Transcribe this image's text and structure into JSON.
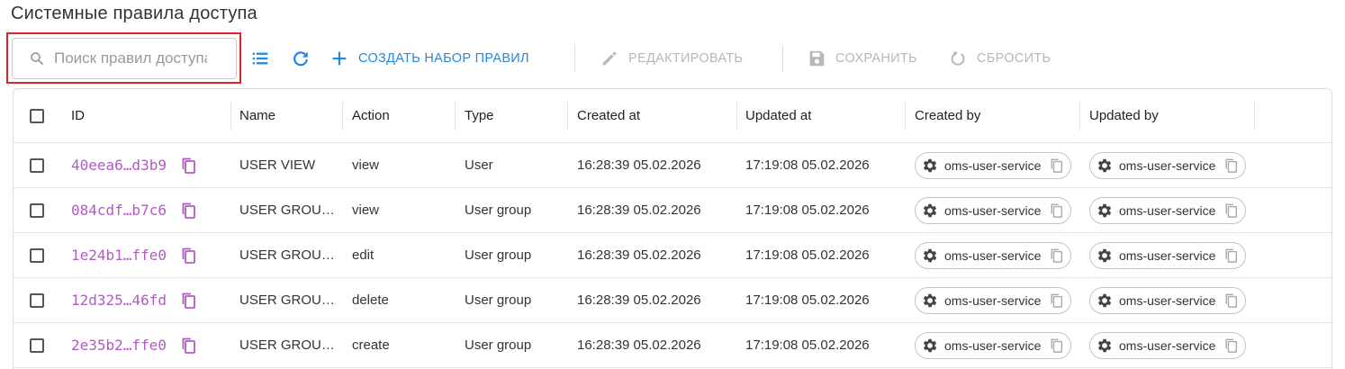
{
  "page": {
    "title": "Системные правила доступа"
  },
  "toolbar": {
    "search_placeholder": "Поиск правил доступа",
    "columns_icon": "list-icon",
    "refresh_icon": "refresh-icon",
    "create_label": "СОЗДАТЬ НАБОР ПРАВИЛ",
    "edit_label": "РЕДАКТИРОВАТЬ",
    "save_label": "СОХРАНИТЬ",
    "reset_label": "СБРОСИТЬ"
  },
  "colors": {
    "accent": "#1e88e5",
    "id_text": "#b05cc2",
    "disabled": "#b7b7b7",
    "highlight": "#d9232d"
  },
  "table": {
    "columns": [
      "ID",
      "Name",
      "Action",
      "Type",
      "Created at",
      "Updated at",
      "Created by",
      "Updated by"
    ],
    "rows": [
      {
        "id": "40eea6…d3b9",
        "name": "USER VIEW",
        "action": "view",
        "type": "User",
        "created_at": "16:28:39 05.02.2026",
        "updated_at": "17:19:08 05.02.2026",
        "created_by": "oms-user-service",
        "updated_by": "oms-user-service"
      },
      {
        "id": "084cdf…b7c6",
        "name": "USER GROU…",
        "action": "view",
        "type": "User group",
        "created_at": "16:28:39 05.02.2026",
        "updated_at": "17:19:08 05.02.2026",
        "created_by": "oms-user-service",
        "updated_by": "oms-user-service"
      },
      {
        "id": "1e24b1…ffe0",
        "name": "USER GROU…",
        "action": "edit",
        "type": "User group",
        "created_at": "16:28:39 05.02.2026",
        "updated_at": "17:19:08 05.02.2026",
        "created_by": "oms-user-service",
        "updated_by": "oms-user-service"
      },
      {
        "id": "12d325…46fd",
        "name": "USER GROU…",
        "action": "delete",
        "type": "User group",
        "created_at": "16:28:39 05.02.2026",
        "updated_at": "17:19:08 05.02.2026",
        "created_by": "oms-user-service",
        "updated_by": "oms-user-service"
      },
      {
        "id": "2e35b2…ffe0",
        "name": "USER GROU…",
        "action": "create",
        "type": "User group",
        "created_at": "16:28:39 05.02.2026",
        "updated_at": "17:19:08 05.02.2026",
        "created_by": "oms-user-service",
        "updated_by": "oms-user-service"
      }
    ]
  }
}
